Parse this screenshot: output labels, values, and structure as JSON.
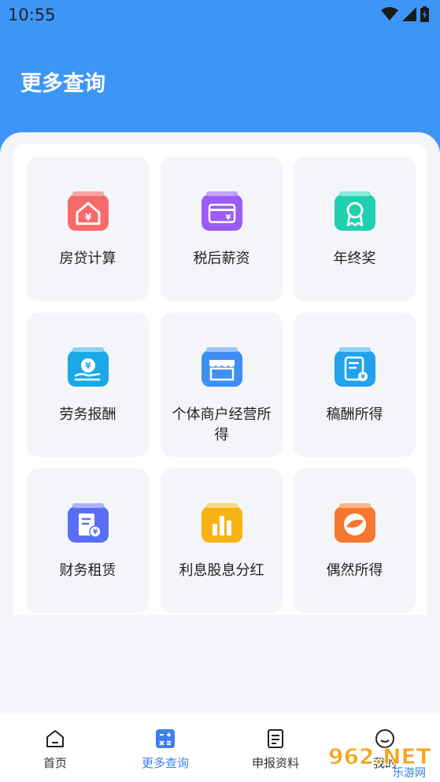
{
  "status_bar": {
    "time": "10:55"
  },
  "header": {
    "title": "更多查询"
  },
  "cards": [
    {
      "label": "房贷计算",
      "icon": "house-yuan-icon",
      "color": "#f66a6a"
    },
    {
      "label": "税后薪资",
      "icon": "card-yuan-icon",
      "color": "#9b5cf6"
    },
    {
      "label": "年终奖",
      "icon": "award-badge-icon",
      "color": "#1fd0b0"
    },
    {
      "label": "劳务报酬",
      "icon": "hand-coin-icon",
      "color": "#1aa9e6"
    },
    {
      "label": "个体商户经营所得",
      "icon": "store-icon",
      "color": "#3d8ef5"
    },
    {
      "label": "稿酬所得",
      "icon": "document-yuan-icon",
      "color": "#22a2ea"
    },
    {
      "label": "财务租赁",
      "icon": "receipt-yuan-icon",
      "color": "#5a6ef5"
    },
    {
      "label": "利息股息分红",
      "icon": "bar-chart-icon",
      "color": "#f9b214"
    },
    {
      "label": "偶然所得",
      "icon": "circle-swoosh-icon",
      "color": "#f7772e"
    }
  ],
  "nav": [
    {
      "label": "首页",
      "icon": "home-icon",
      "active": false
    },
    {
      "label": "更多查询",
      "icon": "calculator-icon",
      "active": true
    },
    {
      "label": "申报资料",
      "icon": "document-icon",
      "active": false
    },
    {
      "label": "我的",
      "icon": "profile-icon",
      "active": false
    }
  ],
  "watermark": {
    "text": "962.NET",
    "subtext": "乐游网"
  }
}
